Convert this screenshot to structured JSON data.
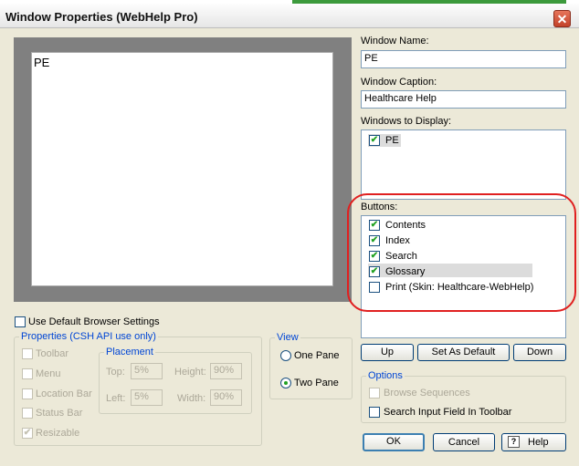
{
  "window": {
    "title": "Window Properties (WebHelp Pro)",
    "close_glyph": "✕"
  },
  "preview": {
    "text": "PE"
  },
  "window_name": {
    "label": "Window Name:",
    "value": "PE"
  },
  "window_caption": {
    "label": "Window Caption:",
    "value": "Healthcare Help"
  },
  "windows_to_display": {
    "label": "Windows to Display:",
    "items": [
      {
        "label": "PE",
        "checked": true
      }
    ]
  },
  "buttons": {
    "label": "Buttons:",
    "items": [
      {
        "label": "Contents",
        "checked": true
      },
      {
        "label": "Index",
        "checked": true
      },
      {
        "label": "Search",
        "checked": true
      },
      {
        "label": "Glossary",
        "checked": true
      },
      {
        "label": "Print (Skin: Healthcare-WebHelp)",
        "checked": false
      }
    ]
  },
  "order_buttons": {
    "up": "Up",
    "set_default": "Set As Default",
    "down": "Down"
  },
  "use_default_browser": {
    "label": "Use Default Browser Settings",
    "checked": false
  },
  "properties": {
    "title": "Properties (CSH API use only)",
    "toolbar": "Toolbar",
    "menu": "Menu",
    "location_bar": "Location Bar",
    "status_bar": "Status Bar",
    "resizable": "Resizable",
    "placement": {
      "title": "Placement",
      "top_label": "Top:",
      "top_value": "5%",
      "height_label": "Height:",
      "height_value": "90%",
      "left_label": "Left:",
      "left_value": "5%",
      "width_label": "Width:",
      "width_value": "90%"
    }
  },
  "view": {
    "title": "View",
    "one_pane": "One Pane",
    "two_pane": "Two Pane",
    "selected": "two_pane"
  },
  "options": {
    "title": "Options",
    "browse_sequences": "Browse Sequences",
    "search_input": "Search Input Field In Toolbar"
  },
  "dialog_buttons": {
    "ok": "OK",
    "cancel": "Cancel",
    "help": "Help",
    "help_icon": "?"
  },
  "check_glyph": "✔",
  "colors": {
    "highlight_oval": "#e02020",
    "group_label": "#0046d5",
    "checkmark": "#21a121"
  }
}
